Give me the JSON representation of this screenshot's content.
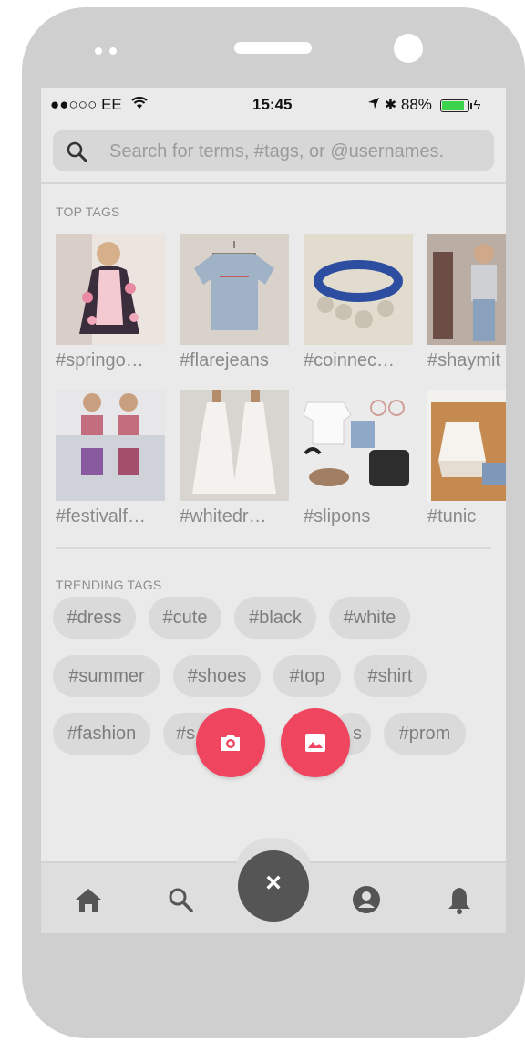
{
  "status_bar": {
    "signal": "●●○○○ EE",
    "time": "15:45",
    "battery": "88%"
  },
  "search": {
    "placeholder": "Search for terms, #tags, or @usernames."
  },
  "top_tags": {
    "label": "TOP TAGS",
    "items": [
      {
        "tag": "#springo…",
        "image": "floral kimono outfit"
      },
      {
        "tag": "#flarejeans",
        "image": "grey t-shirt on hanger"
      },
      {
        "tag": "#coinnec…",
        "image": "blue coin bracelet"
      },
      {
        "tag": "#shaymit",
        "image": "girls in denim"
      },
      {
        "tag": "#festivalf…",
        "image": "two girls in matching sets"
      },
      {
        "tag": "#whitedr…",
        "image": "white lace dresses"
      },
      {
        "tag": "#slipons",
        "image": "flat lay with sandals and bag"
      },
      {
        "tag": "#tunic",
        "image": "white tunic on hanger"
      }
    ]
  },
  "trending_tags": {
    "label": "TRENDING TAGS",
    "rows": [
      [
        "#dress",
        "#cute",
        "#black",
        "#white"
      ],
      [
        "#summer",
        "#shoes",
        "#top",
        "#shirt"
      ],
      [
        "#fashion",
        "#s",
        "s",
        "#prom"
      ]
    ]
  },
  "actions": {
    "camera": "camera-icon",
    "gallery": "image-icon",
    "close": "×"
  },
  "tab_bar": {
    "items": [
      "home-icon",
      "search-icon",
      "close-icon",
      "profile-icon",
      "bell-icon"
    ]
  },
  "colors": {
    "accent": "#f0455f",
    "close_button": "#555555",
    "battery_fill": "#3bd34a"
  }
}
